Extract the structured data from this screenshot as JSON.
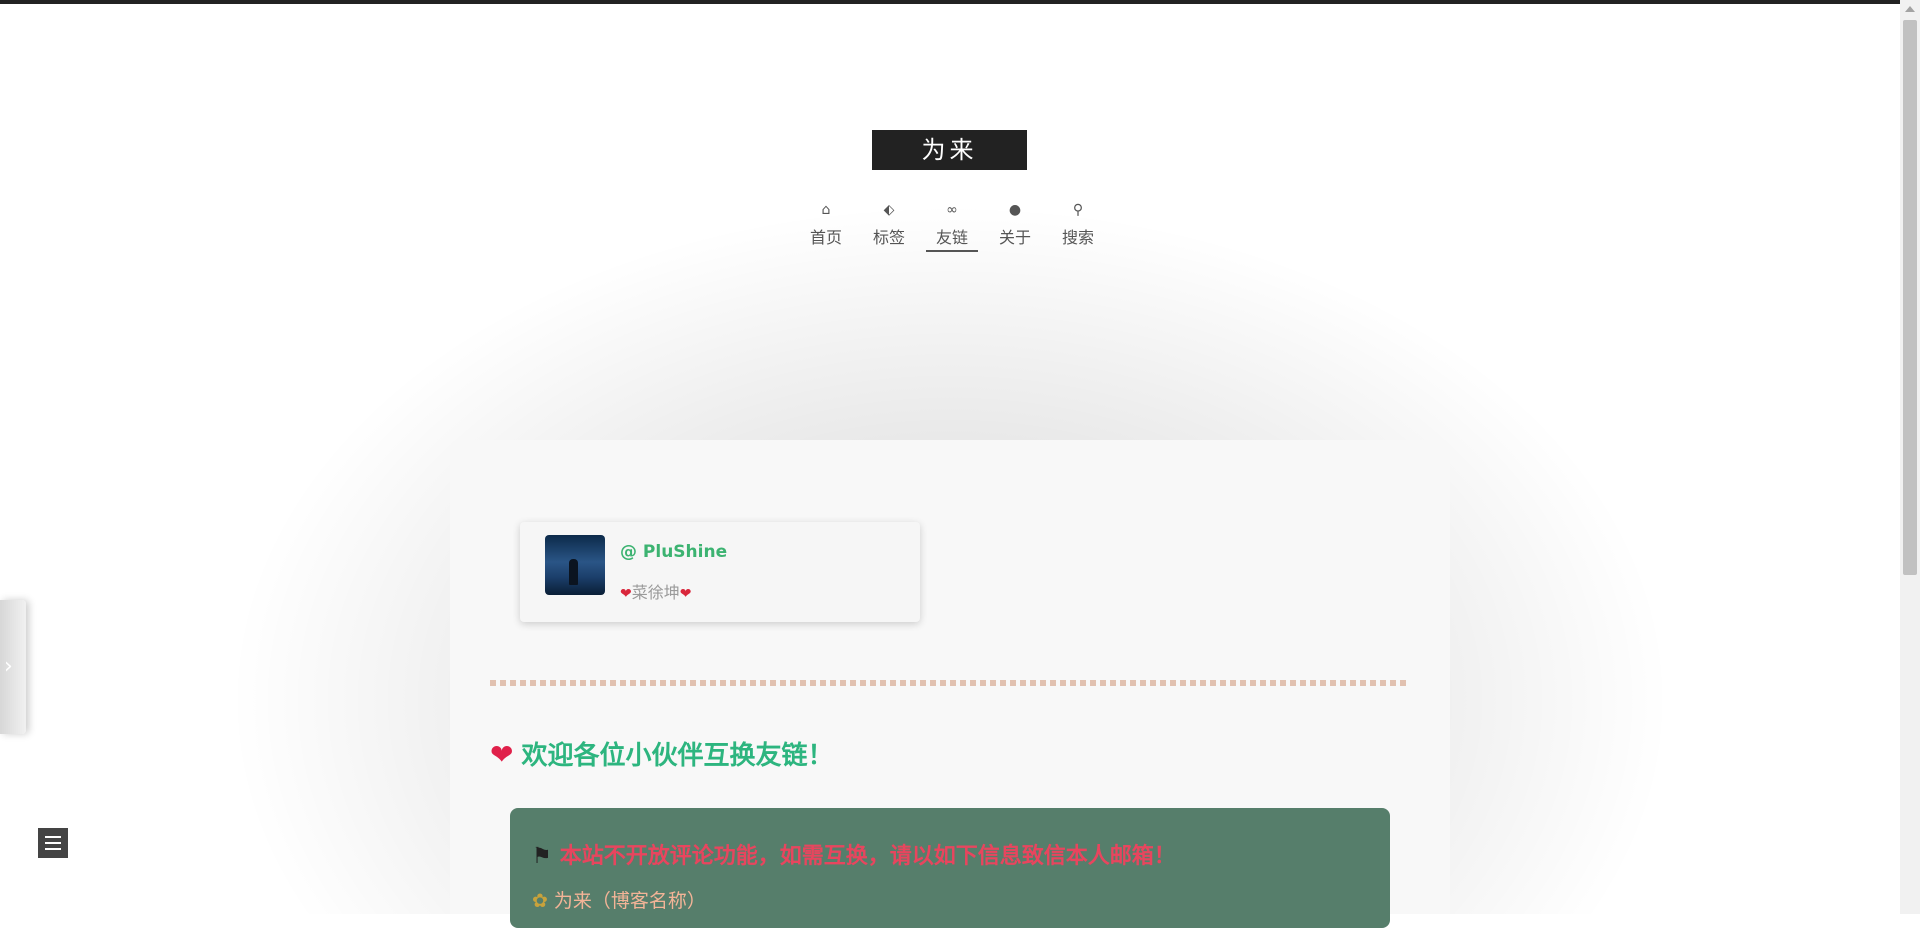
{
  "site": {
    "brand_title": "为来"
  },
  "nav": {
    "items": [
      {
        "icon": "home-icon",
        "label": "首页"
      },
      {
        "icon": "tag-icon",
        "label": "标签"
      },
      {
        "icon": "link-icon",
        "label": "友链",
        "active": true
      },
      {
        "icon": "user-icon",
        "label": "关于"
      },
      {
        "icon": "search-icon",
        "label": "搜索"
      }
    ],
    "icons": {
      "home": "⌂",
      "tag": "⬖",
      "link": "∞",
      "user": "●",
      "search": "⚲"
    }
  },
  "friends": [
    {
      "name": "@ PluShine",
      "desc": "菜徐坤",
      "heart": "❤"
    }
  ],
  "welcome": {
    "emoji": "❤",
    "text": "欢迎各位小伙伴互换友链！"
  },
  "notice": {
    "line1_emoji": "⚑",
    "line1": "本站不开放评论功能，如需互换，请以如下信息致信本人邮箱！",
    "line2_emoji": "✿",
    "line2": "为来（博客名称）"
  },
  "sidebar_toggle": {
    "icon": "chevron-right-icon",
    "glyph": "›"
  },
  "colors": {
    "accent_green": "#2db57f",
    "notice_bg": "#567e6b",
    "notice_red": "#e8455e",
    "notice_peach": "#f3b497"
  }
}
